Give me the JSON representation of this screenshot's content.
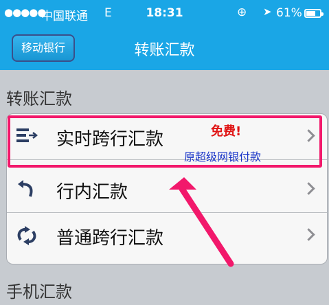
{
  "status_bar": {
    "signal": "●●●●●",
    "carrier": "中国联通",
    "network": "E",
    "time": "18:31",
    "battery": "61%"
  },
  "nav": {
    "back_label": "移动银行",
    "title": "转账汇款"
  },
  "sections": {
    "transfer_header": "转账汇款",
    "mobile_header": "手机汇款"
  },
  "rows": [
    {
      "label": "实时跨行汇款",
      "icon": "fast-transfer-icon"
    },
    {
      "label": "行内汇款",
      "icon": "return-arrow-icon"
    },
    {
      "label": "普通跨行汇款",
      "icon": "refresh-arrows-icon"
    }
  ],
  "annotations": {
    "free": "免费!",
    "formerly": "原超级网银付款",
    "highlight_color": "#f2186b"
  },
  "colors": {
    "header_blue": "#1aa6e6",
    "background": "#c7cbd0"
  }
}
